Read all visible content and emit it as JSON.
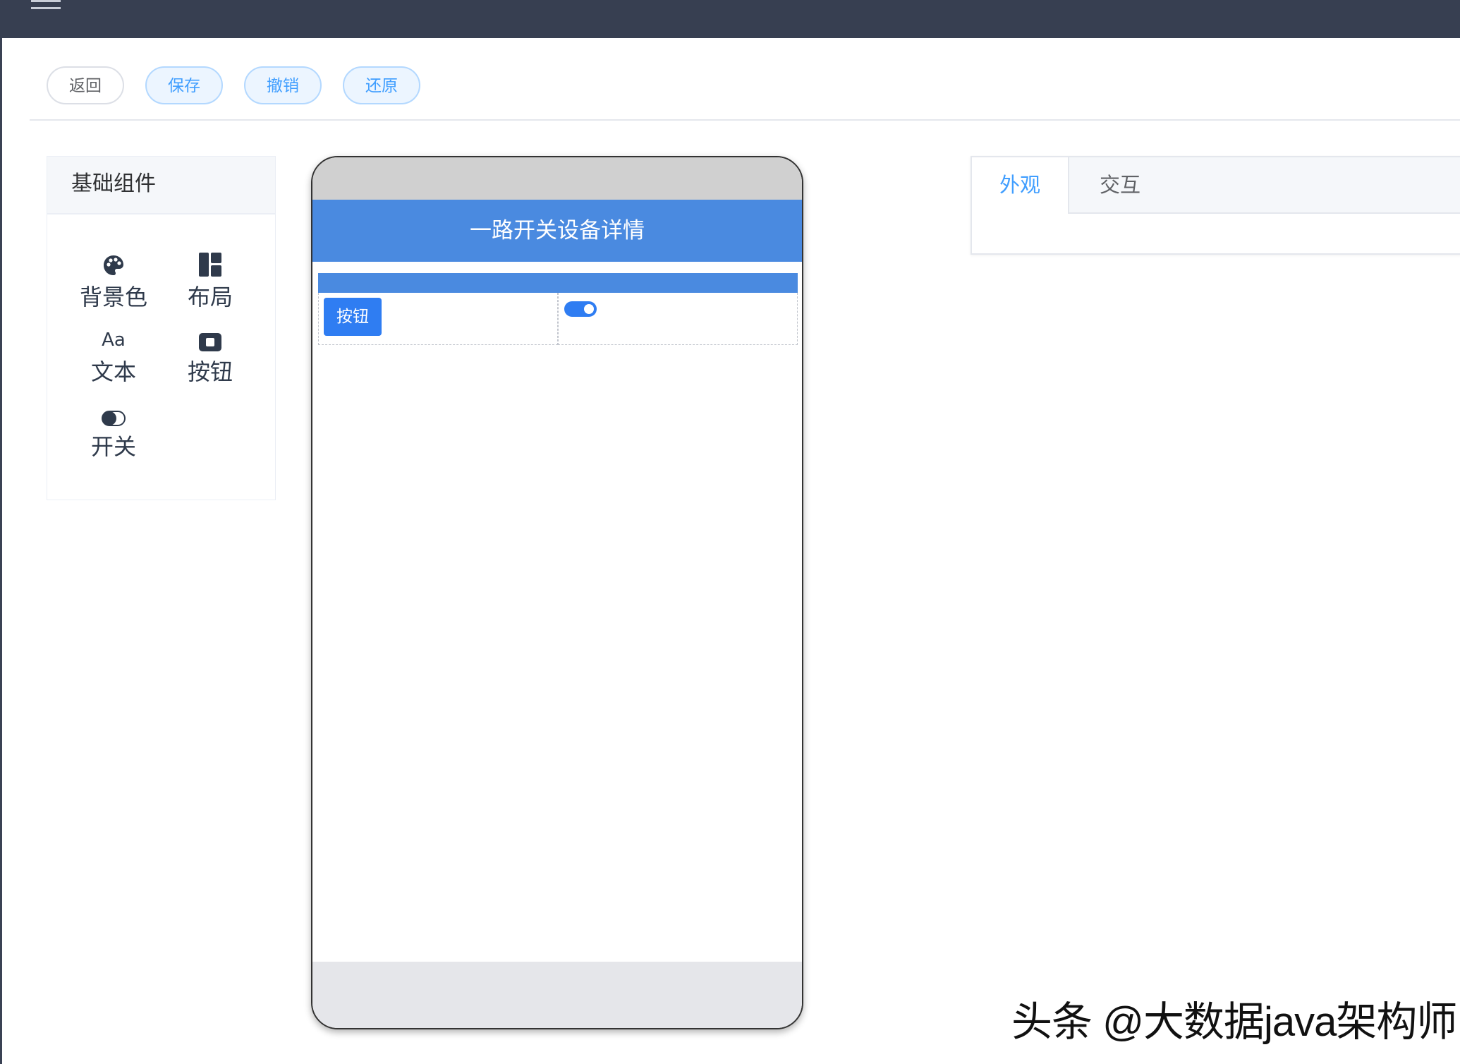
{
  "toolbar": {
    "back": "返回",
    "save": "保存",
    "undo": "撤销",
    "restore": "还原"
  },
  "components": {
    "title": "基础组件",
    "items": [
      {
        "label": "背景色",
        "icon": "palette-icon"
      },
      {
        "label": "布局",
        "icon": "layout-icon"
      },
      {
        "label": "文本",
        "icon": "text-icon",
        "icon_text": "Aa"
      },
      {
        "label": "按钮",
        "icon": "button-icon"
      },
      {
        "label": "开关",
        "icon": "toggle-icon"
      }
    ]
  },
  "phone": {
    "title": "一路开关设备详情",
    "cell_button": "按钮",
    "switch_on": true
  },
  "attributes": {
    "tabs": [
      {
        "label": "外观",
        "active": true
      },
      {
        "label": "交互",
        "active": false
      }
    ]
  },
  "watermark": "头条 @大数据java架构师",
  "colors": {
    "topbar": "#373f51",
    "accent": "#409eff",
    "phone_header": "#4a8ae0",
    "button": "#2f7df2"
  }
}
